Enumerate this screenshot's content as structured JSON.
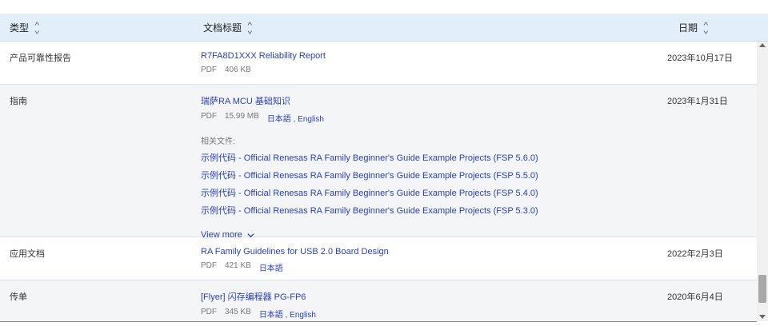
{
  "header": {
    "type_label": "类型",
    "title_label": "文档标题",
    "date_label": "日期"
  },
  "rows": [
    {
      "type": "产品可靠性报告",
      "title": "R7FA8D1XXX Reliability Report",
      "format": "PDF",
      "size": "406 KB",
      "languages": "",
      "date": "2023年10月17日"
    },
    {
      "type": "指南",
      "title": "瑞萨RA MCU 基础知识",
      "format": "PDF",
      "size": "15.99 MB",
      "languages": "日本語 , English",
      "date": "2023年1月31日",
      "related_label": "相关文件:",
      "related": [
        "示例代码 - Official Renesas RA Family Beginner's Guide Example Projects (FSP 5.6.0)",
        "示例代码 - Official Renesas RA Family Beginner's Guide Example Projects (FSP 5.5.0)",
        "示例代码 - Official Renesas RA Family Beginner's Guide Example Projects (FSP 5.4.0)",
        "示例代码 - Official Renesas RA Family Beginner's Guide Example Projects (FSP 5.3.0)"
      ],
      "view_more": "View more"
    },
    {
      "type": "应用文档",
      "title": "RA Family Guidelines for USB 2.0 Board Design",
      "format": "PDF",
      "size": "421 KB",
      "languages": "日本語",
      "date": "2022年2月3日"
    },
    {
      "type": "传单",
      "title": "[Flyer] 闪存编程器 PG-FP6",
      "format": "PDF",
      "size": "345 KB",
      "languages": "日本語 , English",
      "date": "2020年6月4日"
    }
  ],
  "colors": {
    "header_bg": "#e3eefb",
    "link": "#2a3fb5",
    "alt_row_bg": "#f4f5f7"
  }
}
